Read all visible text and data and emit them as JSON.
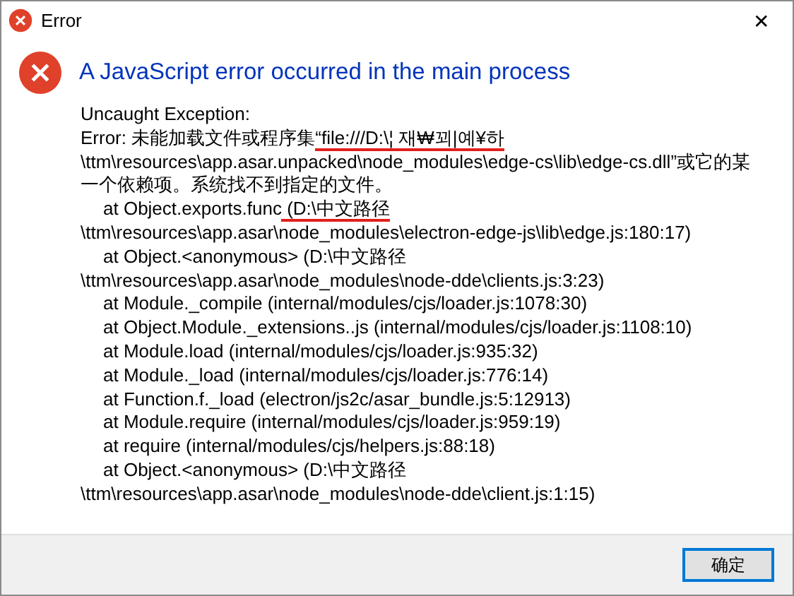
{
  "window": {
    "title": "Error",
    "close_glyph": "✕"
  },
  "heading": "A JavaScript error occurred in the main process",
  "message_lines": [
    {
      "indent": false,
      "segments": [
        {
          "text": "Uncaught Exception:",
          "underlined": false
        }
      ]
    },
    {
      "indent": false,
      "segments": [
        {
          "text": "Error: 未能加载文件或程序集",
          "underlined": false
        },
        {
          "text": "“file:///D:\\¦ 재₩꾀|예¥하",
          "underlined": true
        }
      ]
    },
    {
      "indent": false,
      "segments": [
        {
          "text": "\\ttm\\resources\\app.asar.unpacked\\node_modules\\edge-cs\\lib\\edge-cs.dll”或它的某",
          "underlined": false
        }
      ]
    },
    {
      "indent": false,
      "segments": [
        {
          "text": "一个依赖项。系统找不到指定的文件。",
          "underlined": false
        }
      ]
    },
    {
      "indent": true,
      "segments": [
        {
          "text": "at Object.exports.func",
          "underlined": false
        },
        {
          "text": " (D:\\中文路径",
          "underlined": true
        }
      ]
    },
    {
      "indent": false,
      "segments": [
        {
          "text": "\\ttm\\resources\\app.asar\\node_modules\\electron-edge-js\\lib\\edge.js:180:17)",
          "underlined": false
        }
      ]
    },
    {
      "indent": true,
      "segments": [
        {
          "text": "at Object.<anonymous> (D:\\中文路径",
          "underlined": false
        }
      ]
    },
    {
      "indent": false,
      "segments": [
        {
          "text": "\\ttm\\resources\\app.asar\\node_modules\\node-dde\\clients.js:3:23)",
          "underlined": false
        }
      ]
    },
    {
      "indent": true,
      "segments": [
        {
          "text": "at Module._compile (internal/modules/cjs/loader.js:1078:30)",
          "underlined": false
        }
      ]
    },
    {
      "indent": true,
      "segments": [
        {
          "text": "at Object.Module._extensions..js (internal/modules/cjs/loader.js:1108:10)",
          "underlined": false
        }
      ]
    },
    {
      "indent": true,
      "segments": [
        {
          "text": "at Module.load (internal/modules/cjs/loader.js:935:32)",
          "underlined": false
        }
      ]
    },
    {
      "indent": true,
      "segments": [
        {
          "text": "at Module._load (internal/modules/cjs/loader.js:776:14)",
          "underlined": false
        }
      ]
    },
    {
      "indent": true,
      "segments": [
        {
          "text": "at Function.f._load (electron/js2c/asar_bundle.js:5:12913)",
          "underlined": false
        }
      ]
    },
    {
      "indent": true,
      "segments": [
        {
          "text": "at Module.require (internal/modules/cjs/loader.js:959:19)",
          "underlined": false
        }
      ]
    },
    {
      "indent": true,
      "segments": [
        {
          "text": "at require (internal/modules/cjs/helpers.js:88:18)",
          "underlined": false
        }
      ]
    },
    {
      "indent": true,
      "segments": [
        {
          "text": "at Object.<anonymous> (D:\\中文路径",
          "underlined": false
        }
      ]
    },
    {
      "indent": false,
      "segments": [
        {
          "text": "\\ttm\\resources\\app.asar\\node_modules\\node-dde\\client.js:1:15)",
          "underlined": false
        }
      ]
    }
  ],
  "buttons": [
    {
      "label": "确定",
      "selected": true
    }
  ]
}
